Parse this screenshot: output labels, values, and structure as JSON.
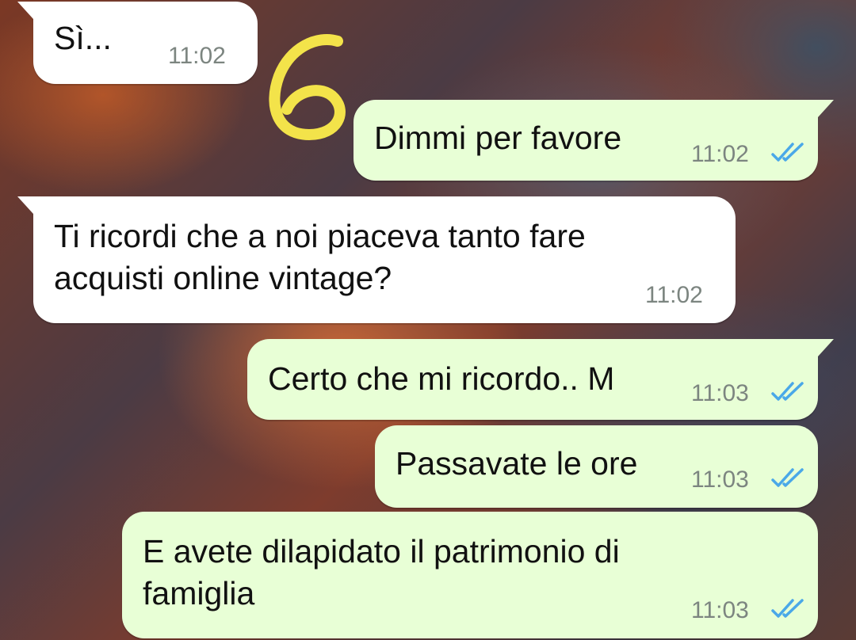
{
  "colors": {
    "incoming_bubble": "#ffffff",
    "outgoing_bubble": "#e8ffd6",
    "timestamp": "#7c8580",
    "read_ticks": "#4aa8e8",
    "annotation_yellow": "#f3e34a"
  },
  "annotation": {
    "icon": "handwritten-six-icon",
    "text": "6"
  },
  "messages": [
    {
      "direction": "incoming",
      "text": "Sì...",
      "time": "11:02"
    },
    {
      "direction": "outgoing",
      "text": "Dimmi per favore",
      "time": "11:02",
      "status_icon": "double-check-read-icon"
    },
    {
      "direction": "incoming",
      "text": "Ti ricordi che a noi piaceva tanto fare\nacquisti online vintage?",
      "time": "11:02"
    },
    {
      "direction": "outgoing",
      "text": "Certo che mi ricordo.. M",
      "time": "11:03",
      "status_icon": "double-check-read-icon"
    },
    {
      "direction": "outgoing",
      "text": "Passavate le ore",
      "time": "11:03",
      "status_icon": "double-check-read-icon"
    },
    {
      "direction": "outgoing",
      "text": "E avete dilapidato il patrimonio di\nfamiglia",
      "time": "11:03",
      "status_icon": "double-check-read-icon"
    }
  ]
}
